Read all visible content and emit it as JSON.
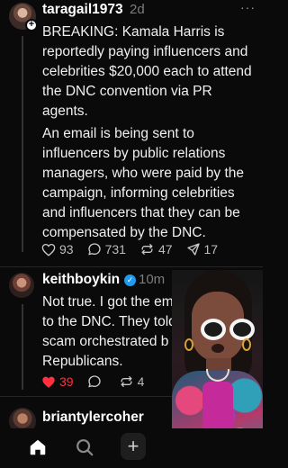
{
  "post1": {
    "username": "taragail1973",
    "time": "2d",
    "more": "···",
    "follow_icon": "+",
    "paragraph1": "BREAKING: Kamala Harris is reportedly paying influencers and celebrities $20,000 each to attend the DNC convention via PR agents.",
    "paragraph2": "An email is being sent to influencers by public relations managers, who were paid by the campaign, informing celebrities and influencers that they can be compensated by the DNC.",
    "likes": "93",
    "replies": "731",
    "reposts": "47",
    "shares": "17"
  },
  "post2": {
    "username": "keithboykin",
    "verified_icon": "✓",
    "time": "10m",
    "more": "···",
    "paragraph": "Not true. I got the em to the DNC. They told scam orchestrated b Republicans.",
    "lines": [
      "Not true. I got the em",
      "to the DNC. They told",
      "scam orchestrated b",
      "Republicans."
    ],
    "likes": "39",
    "reposts": "4",
    "like_color": "#ff3040"
  },
  "post3": {
    "username": "briantylercoher"
  },
  "bottom_nav": {
    "items": [
      "home-icon",
      "search-icon",
      "new-post-icon"
    ],
    "new_symbol": "+"
  },
  "colors": {
    "background": "#0a0a0a",
    "text": "#f3f3f3",
    "muted": "#7d7d7d",
    "verified": "#1d9bf0",
    "like": "#ff3040"
  }
}
